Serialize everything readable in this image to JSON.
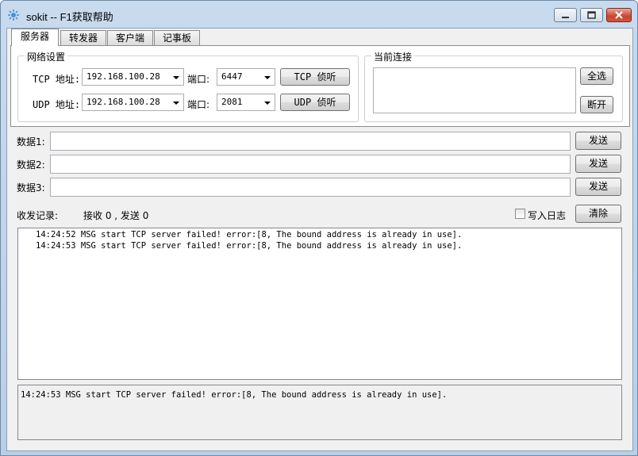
{
  "window": {
    "title": "sokit -- F1获取帮助"
  },
  "tabs": [
    {
      "label": "服务器",
      "active": true
    },
    {
      "label": "转发器",
      "active": false
    },
    {
      "label": "客户端",
      "active": false
    },
    {
      "label": "记事板",
      "active": false
    }
  ],
  "network": {
    "group_title": "网络设置",
    "tcp": {
      "label": "TCP 地址:",
      "address": "192.168.100.28",
      "port_label": "端口:",
      "port": "6447",
      "button": "TCP 侦听"
    },
    "udp": {
      "label": "UDP 地址:",
      "address": "192.168.100.28",
      "port_label": "端口:",
      "port": "2081",
      "button": "UDP 侦听"
    }
  },
  "connections": {
    "group_title": "当前连接",
    "select_all_button": "全选",
    "disconnect_button": "断开"
  },
  "data_rows": [
    {
      "label": "数据1:",
      "value": "",
      "button": "发送"
    },
    {
      "label": "数据2:",
      "value": "",
      "button": "发送"
    },
    {
      "label": "数据3:",
      "value": "",
      "button": "发送"
    }
  ],
  "records": {
    "label": "收发记录:",
    "stats": "接收 0 , 发送 0",
    "write_log_label": "写入日志",
    "write_log_checked": false,
    "clear_button": "清除",
    "log_lines": [
      "14:24:52 MSG start TCP server failed! error:[8, The bound address is already in use].",
      "14:24:53 MSG start TCP server failed! error:[8, The bound address is already in use]."
    ]
  },
  "status_message": "14:24:53 MSG start TCP server failed! error:[8, The bound address is already in use].",
  "colors": {
    "title_bar": "#c8daee",
    "close_button": "#c74530",
    "dialog_background": "#f0f0f0"
  }
}
